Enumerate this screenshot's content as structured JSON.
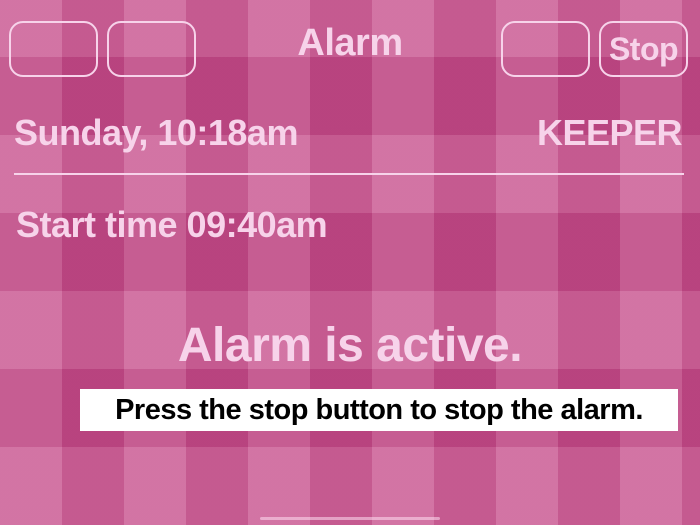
{
  "header": {
    "title": "Alarm",
    "stop_label": "Stop"
  },
  "status": {
    "day_time": "Sunday, 10:18am",
    "mode": "KEEPER"
  },
  "start": {
    "text": "Start time 09:40am"
  },
  "message": {
    "active": "Alarm is active.",
    "instruction": "Press the stop button to stop the alarm."
  },
  "colors": {
    "background": "#c8538f",
    "text": "#f7d3ea",
    "instruction_bg": "#ffffff",
    "instruction_text": "#000000"
  }
}
